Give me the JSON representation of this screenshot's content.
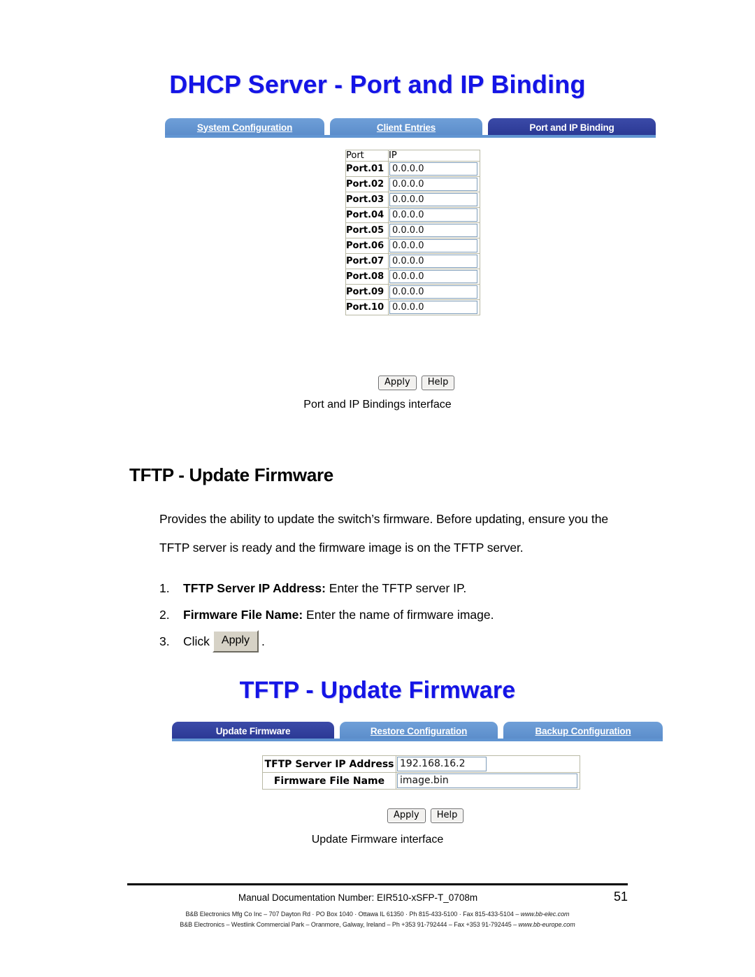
{
  "page": {
    "caption_dhcp": "Port and IP Bindings interface",
    "caption_tftp": "Update Firmware interface"
  },
  "dhcp_widget": {
    "title": "DHCP Server - Port and IP Binding",
    "tabs": [
      {
        "label": "System Configuration",
        "active": false
      },
      {
        "label": "Client Entries",
        "active": false
      },
      {
        "label": "Port and IP Binding",
        "active": true
      }
    ],
    "table": {
      "headers": [
        "Port",
        "IP"
      ],
      "rows": [
        {
          "port": "Port.01",
          "ip": "0.0.0.0"
        },
        {
          "port": "Port.02",
          "ip": "0.0.0.0"
        },
        {
          "port": "Port.03",
          "ip": "0.0.0.0"
        },
        {
          "port": "Port.04",
          "ip": "0.0.0.0"
        },
        {
          "port": "Port.05",
          "ip": "0.0.0.0"
        },
        {
          "port": "Port.06",
          "ip": "0.0.0.0"
        },
        {
          "port": "Port.07",
          "ip": "0.0.0.0"
        },
        {
          "port": "Port.08",
          "ip": "0.0.0.0"
        },
        {
          "port": "Port.09",
          "ip": "0.0.0.0"
        },
        {
          "port": "Port.10",
          "ip": "0.0.0.0"
        }
      ]
    },
    "buttons": {
      "apply": "Apply",
      "help": "Help"
    }
  },
  "section": {
    "heading": "TFTP - Update Firmware",
    "paragraph": "Provides the ability to update the switch’s firmware. Before updating, ensure you the TFTP server is ready and the firmware image is on the TFTP server.",
    "steps": [
      {
        "num": "1.",
        "bold": "TFTP Server IP Address:",
        "text": " Enter the TFTP server IP.",
        "button": ""
      },
      {
        "num": "2.",
        "bold": "Firmware File Name:",
        "text": "  Enter the name of firmware image.",
        "button": ""
      },
      {
        "num": "3.",
        "bold": "",
        "text": "Click",
        "button": "Apply",
        "tail": "."
      }
    ]
  },
  "tftp_widget": {
    "title": "TFTP - Update Firmware",
    "tabs": [
      {
        "label": "Update Firmware",
        "active": true
      },
      {
        "label": "Restore Configuration",
        "active": false
      },
      {
        "label": "Backup Configuration",
        "active": false
      }
    ],
    "fields": [
      {
        "label": "TFTP Server IP Address",
        "value": "192.168.16.2"
      },
      {
        "label": "Firmware File Name",
        "value": "image.bin"
      }
    ],
    "buttons": {
      "apply": "Apply",
      "help": "Help"
    }
  },
  "footer": {
    "doc_number": "Manual Documentation Number: EIR510-xSFP-T_0708m",
    "page_number": "51",
    "address_line_1_pre": "B&B Electronics Mfg Co Inc – 707 Dayton Rd · PO Box 1040 · Ottawa IL 61350 · Ph 815-433-5100 · Fax 815-433-5104 – ",
    "address_line_1_url": "www.bb-elec.com",
    "address_line_2_pre": "B&B Electronics – Westlink Commercial Park – Oranmore, Galway, Ireland – Ph +353 91-792444 – Fax +353 91-792445 – ",
    "address_line_2_url": "www.bb-europe.com"
  }
}
